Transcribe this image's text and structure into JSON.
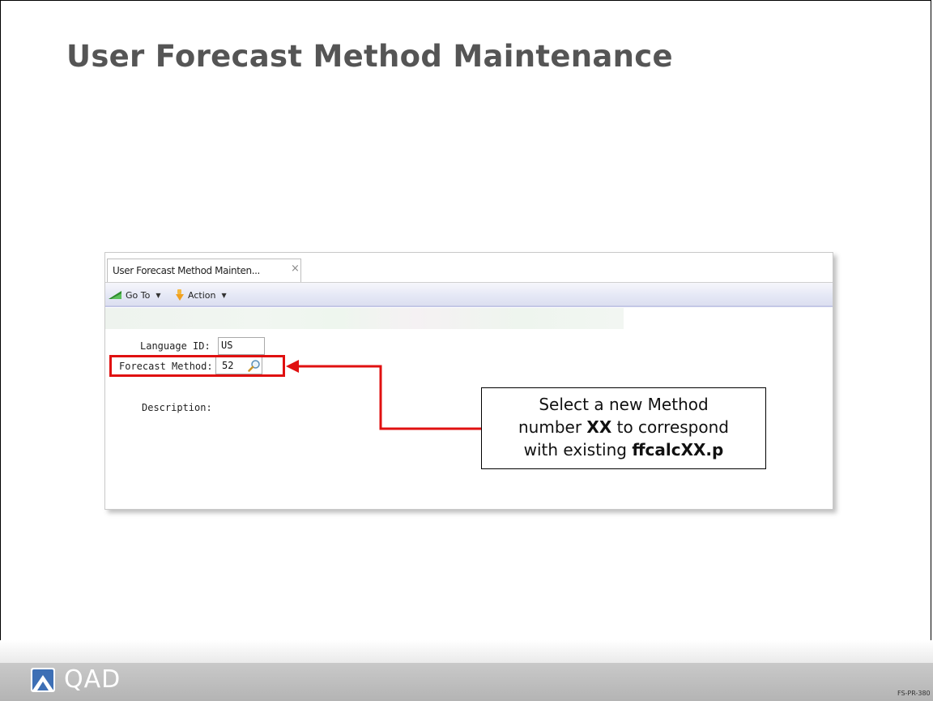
{
  "slide": {
    "title": "User Forecast Method Maintenance",
    "code": "FS-PR-380"
  },
  "window": {
    "tab_label": "User Forecast Method Mainten...",
    "tab_close": "×",
    "toolbar": {
      "goto_label": "Go To",
      "action_label": "Action",
      "goto_icon": "goto-arrow-icon",
      "action_icon": "action-pointer-icon"
    },
    "form": {
      "language_label": "Language ID:",
      "language_value": "US",
      "forecast_method_label": "Forecast Method:",
      "forecast_method_value": "52",
      "description_label": "Description:"
    }
  },
  "callout": {
    "line1": "Select a new Method",
    "line2_pre": "number ",
    "line2_bold": "XX",
    "line2_post": " to correspond",
    "line3_pre": "with existing ",
    "line3_bold": "ffcalcXX.p"
  },
  "footer": {
    "logo_text": "QAD"
  },
  "colors": {
    "highlight": "#e01010",
    "title": "#555555",
    "footer": "#b4b4b4"
  }
}
